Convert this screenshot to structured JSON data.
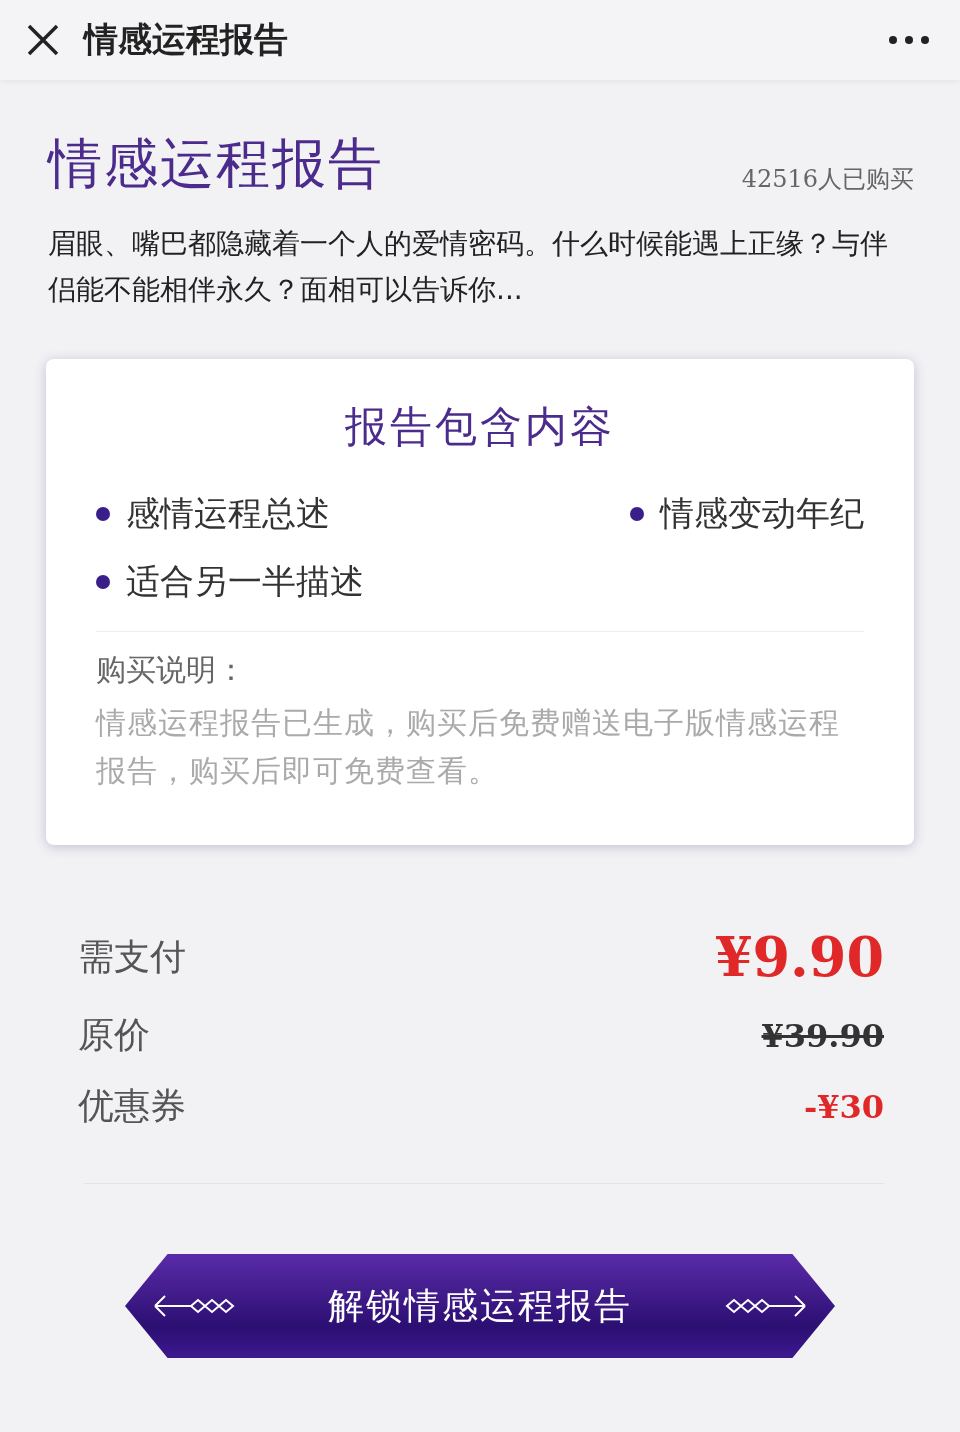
{
  "nav": {
    "title": "情感运程报告"
  },
  "header": {
    "title": "情感运程报告",
    "purchase_count": "42516人已购买",
    "description": "眉眼、嘴巴都隐藏着一个人的爱情密码。什么时候能遇上正缘？与伴侣能不能相伴永久？面相可以告诉你..."
  },
  "contents_card": {
    "title": "报告包含内容",
    "items": [
      "感情运程总述",
      "情感变动年纪",
      "适合另一半描述"
    ],
    "note_title": "购买说明：",
    "note": "情感运程报告已生成，购买后免费赠送电子版情感运程报告，购买后即可免费查看。"
  },
  "pricing": {
    "rows": [
      {
        "kind": "due",
        "label": "需支付",
        "value": "¥9.90"
      },
      {
        "kind": "original",
        "label": "原价",
        "value": "¥39.90"
      },
      {
        "kind": "coupon",
        "label": "优惠券",
        "value": "-¥30"
      }
    ]
  },
  "unlock_button": {
    "label": "解锁情感运程报告"
  }
}
